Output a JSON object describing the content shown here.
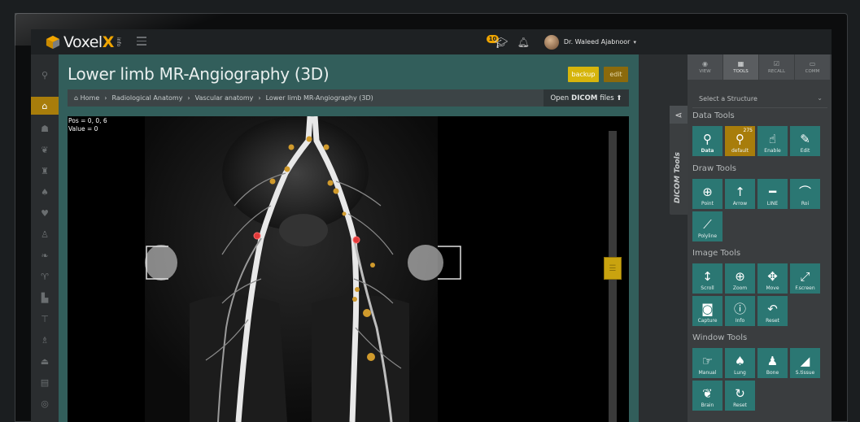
{
  "app": {
    "logo_text_1": "Voxel",
    "logo_text_x": "X",
    "logo_sub": "info",
    "notification_count": "10",
    "user_name": "Dr. Waleed Ajabnoor"
  },
  "main": {
    "title": "Lower limb MR-Angiography (3D)",
    "backup_label": "backup",
    "edit_label": "edit",
    "breadcrumb": [
      "Home",
      "Radiological Anatomy",
      "Vascular anatomy",
      "Lower limb MR-Angiography (3D)"
    ],
    "open_dicom_prefix": "Open",
    "open_dicom_bold": "DICOM",
    "open_dicom_suffix": "files",
    "pos_text": "Pos = 0, 0, 6",
    "value_text": "Value = 0"
  },
  "drawer": {
    "label": "DICOM Tools"
  },
  "right_panel": {
    "tabs": [
      {
        "label": "VIEW",
        "icon": "eye-icon"
      },
      {
        "label": "TOOLS",
        "icon": "grid-icon"
      },
      {
        "label": "RECALL",
        "icon": "checkmark-icon"
      },
      {
        "label": "COMM",
        "icon": "chat-icon"
      }
    ],
    "select_placeholder": "Select a Structure",
    "data_tools_title": "Data Tools",
    "data_tools": [
      {
        "label": "Data",
        "icon": "pin-icon"
      },
      {
        "label": "default",
        "icon": "pin-icon",
        "badge": "275"
      },
      {
        "label": "Enable",
        "icon": "hand-pointer-icon"
      },
      {
        "label": "Edit",
        "icon": "pencil-icon"
      }
    ],
    "draw_tools_title": "Draw Tools",
    "draw_tools": [
      {
        "label": "Point",
        "icon": "crosshair-icon"
      },
      {
        "label": "Arrow",
        "icon": "arrow-up-icon"
      },
      {
        "label": "LINE",
        "icon": "line-icon"
      },
      {
        "label": "Roi",
        "icon": "roi-curve-icon"
      },
      {
        "label": "Polyline",
        "icon": "polyline-icon"
      }
    ],
    "image_tools_title": "Image Tools",
    "image_tools": [
      {
        "label": "Scroll",
        "icon": "scroll-arrows-icon"
      },
      {
        "label": "Zoom",
        "icon": "zoom-icon"
      },
      {
        "label": "Move",
        "icon": "move-icon"
      },
      {
        "label": "F.screen",
        "icon": "fullscreen-icon"
      },
      {
        "label": "Capture",
        "icon": "camera-icon"
      },
      {
        "label": "Info",
        "icon": "info-icon"
      },
      {
        "label": "Reset",
        "icon": "reset-icon"
      }
    ],
    "window_tools_title": "Window Tools",
    "window_tools": [
      {
        "label": "Manual",
        "icon": "manual-hand-icon"
      },
      {
        "label": "Lung",
        "icon": "lungs-icon"
      },
      {
        "label": "Bone",
        "icon": "skeleton-icon"
      },
      {
        "label": "S.tissue",
        "icon": "liver-icon"
      },
      {
        "label": "Brain",
        "icon": "brain-icon"
      },
      {
        "label": "Reset",
        "icon": "reset-icon"
      }
    ]
  },
  "colors": {
    "teal_panel": "#325e5b",
    "tool_teal": "#2b7773",
    "accent_gold": "#a87d0b",
    "backup_yellow": "#d6b50c"
  }
}
